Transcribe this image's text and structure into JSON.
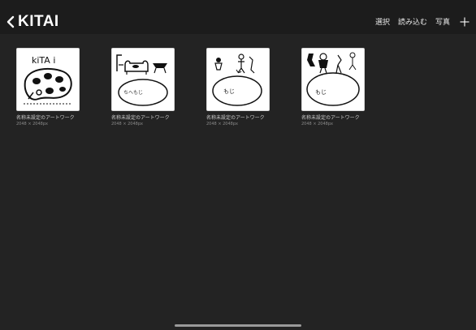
{
  "header": {
    "title": "KITAI",
    "actions": {
      "select": "選択",
      "import": "読み込む",
      "photo": "写真"
    }
  },
  "artworks": [
    {
      "name": "名称未設定のアートワーク",
      "size": "2048 × 2048px",
      "sketch_text": "kiTA i",
      "thumb_icon": "palette-sketch"
    },
    {
      "name": "名称未設定のアートワーク",
      "size": "2048 × 2048px",
      "sketch_text": "ちへもじ",
      "thumb_icon": "sofa-sketch"
    },
    {
      "name": "名称未設定のアートワーク",
      "size": "2048 × 2048px",
      "sketch_text": "もじ",
      "thumb_icon": "people-sketch"
    },
    {
      "name": "名称未設定のアートワーク",
      "size": "2048 × 2048px",
      "sketch_text": "もじ",
      "thumb_icon": "figures-sketch"
    }
  ],
  "colors": {
    "background": "#232323",
    "topbar": "#1c1c1c",
    "text": "#f2f2f2"
  }
}
